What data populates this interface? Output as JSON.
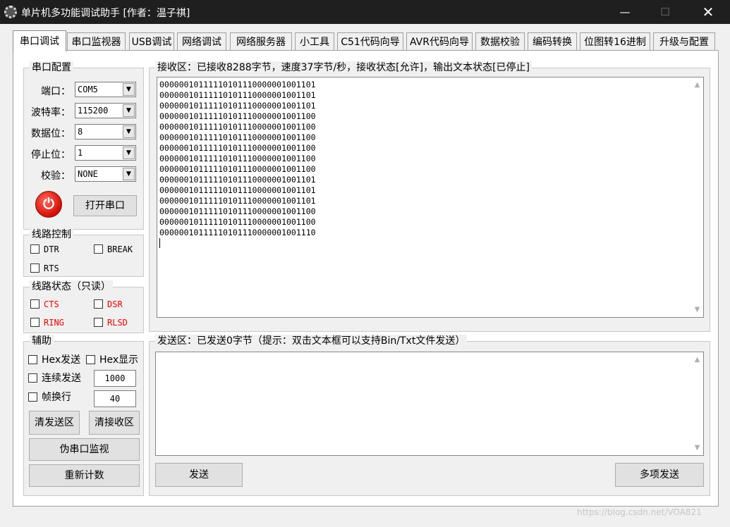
{
  "window": {
    "title": "单片机多功能调试助手 [作者：温子祺]",
    "minimize": "—",
    "maximize": "☐",
    "close": "✕"
  },
  "tabs": [
    "串口调试",
    "串口监视器",
    "USB调试",
    "网络调试",
    "网络服务器",
    "小工具",
    "C51代码向导",
    "AVR代码向导",
    "数据校验",
    "编码转换",
    "位图转16进制",
    "升级与配置"
  ],
  "serial_config": {
    "title": "串口配置",
    "port_label": "端口：",
    "port_value": "COM5",
    "baud_label": "波特率：",
    "baud_value": "115200",
    "databits_label": "数据位：",
    "databits_value": "8",
    "stopbits_label": "停止位：",
    "stopbits_value": "1",
    "parity_label": "校验：",
    "parity_value": "NONE",
    "open_button": "打开串口"
  },
  "line_control": {
    "title": "线路控制",
    "dtr": "DTR",
    "break": "BREAK",
    "rts": "RTS"
  },
  "line_status": {
    "title": "线路状态（只读）",
    "cts": "CTS",
    "dsr": "DSR",
    "ring": "RING",
    "rlsd": "RLSD"
  },
  "assist": {
    "title": "辅助",
    "hex_send": "Hex发送",
    "hex_display": "Hex显示",
    "continuous_send": "连续发送",
    "continuous_value": "1000",
    "frame_newline": "帧换行",
    "frame_value": "40",
    "clear_send": "清发送区",
    "clear_recv": "清接收区",
    "pseudo_monitor": "伪串口监视",
    "recount": "重新计数"
  },
  "receive": {
    "title": "接收区：已接收8288字节，速度37字节/秒，接收状态[允许]，输出文本状态[已停止]",
    "lines": [
      "00000010111110101110000001001101",
      "00000010111110101110000001001101",
      "00000010111110101110000001001101",
      "00000010111110101110000001001100",
      "00000010111110101110000001001100",
      "00000010111110101110000001001100",
      "00000010111110101110000001001100",
      "00000010111110101110000001001100",
      "00000010111110101110000001001100",
      "00000010111110101110000001001101",
      "00000010111110101110000001001101",
      "00000010111110101110000001001101",
      "00000010111110101110000001001100",
      "00000010111110101110000001001100",
      "00000010111110101110000001001110"
    ]
  },
  "send": {
    "title": "发送区：已发送0字节（提示：双击文本框可以支持Bin/Txt文件发送）",
    "send_button": "发送",
    "multi_send_button": "多项发送"
  },
  "watermark": "https://blog.csdn.net/VOA821"
}
